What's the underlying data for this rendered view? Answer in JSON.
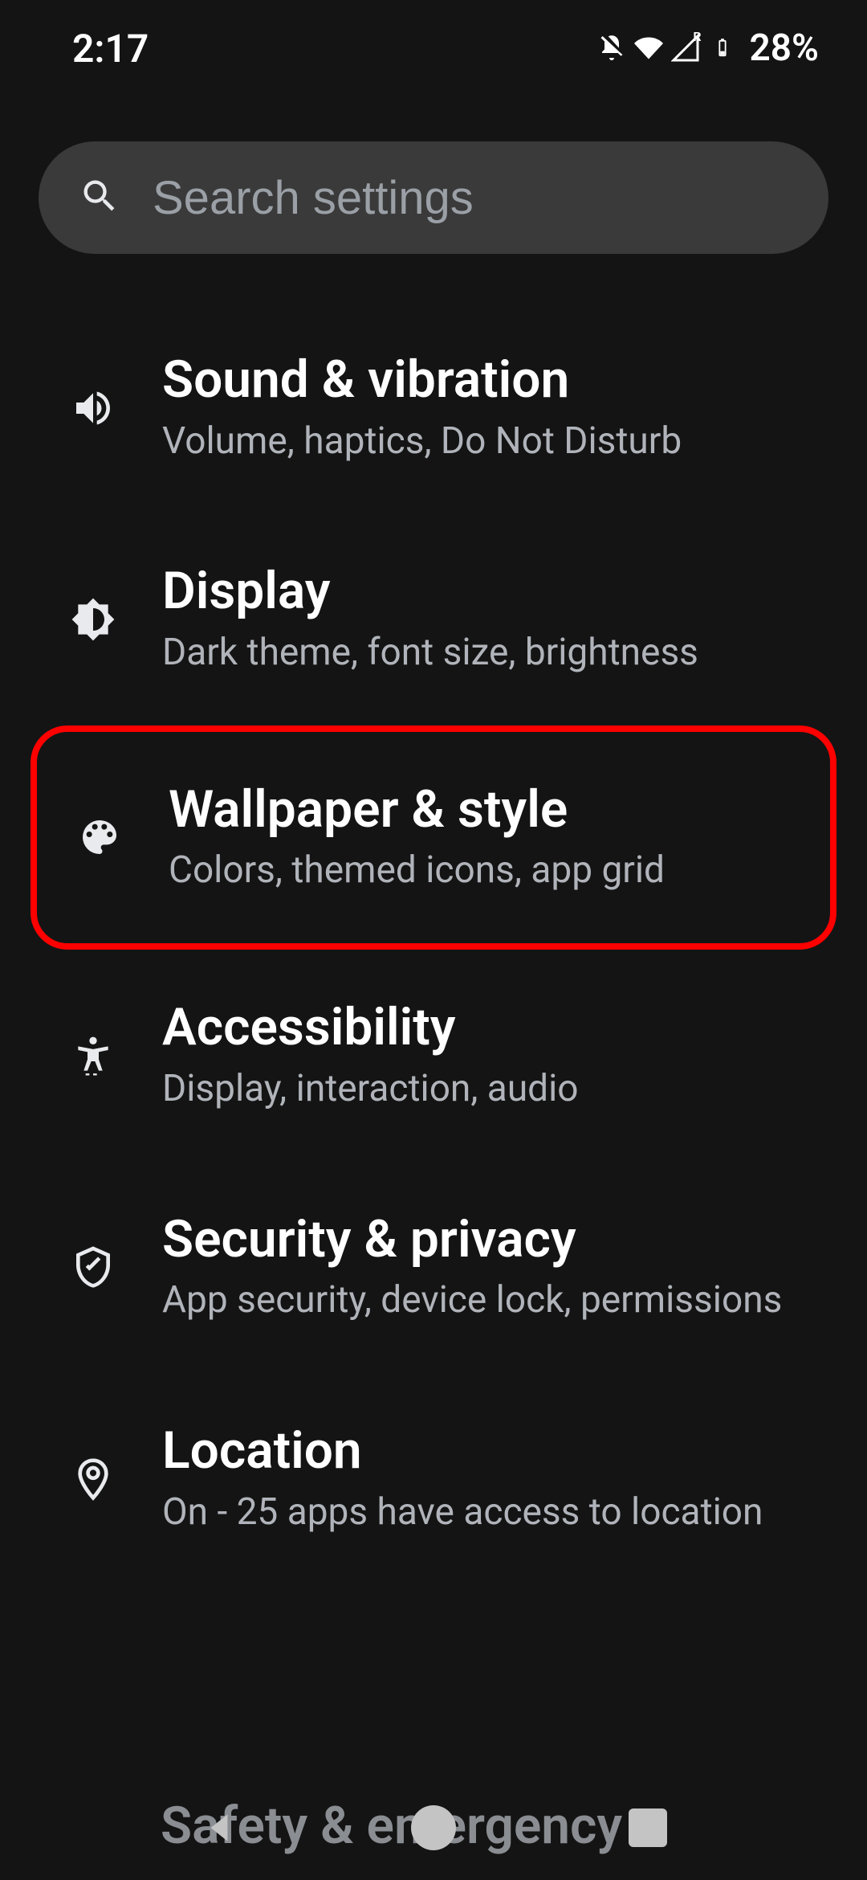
{
  "status": {
    "time": "2:17",
    "battery": "28%"
  },
  "search": {
    "placeholder": "Search settings"
  },
  "items": [
    {
      "title": "Sound & vibration",
      "sub": "Volume, haptics, Do Not Disturb"
    },
    {
      "title": "Display",
      "sub": "Dark theme, font size, brightness"
    },
    {
      "title": "Wallpaper & style",
      "sub": "Colors, themed icons, app grid"
    },
    {
      "title": "Accessibility",
      "sub": "Display, interaction, audio"
    },
    {
      "title": "Security & privacy",
      "sub": "App security, device lock, permissions"
    },
    {
      "title": "Location",
      "sub": "On - 25 apps have access to location"
    }
  ],
  "partial": "Safety & emergency"
}
